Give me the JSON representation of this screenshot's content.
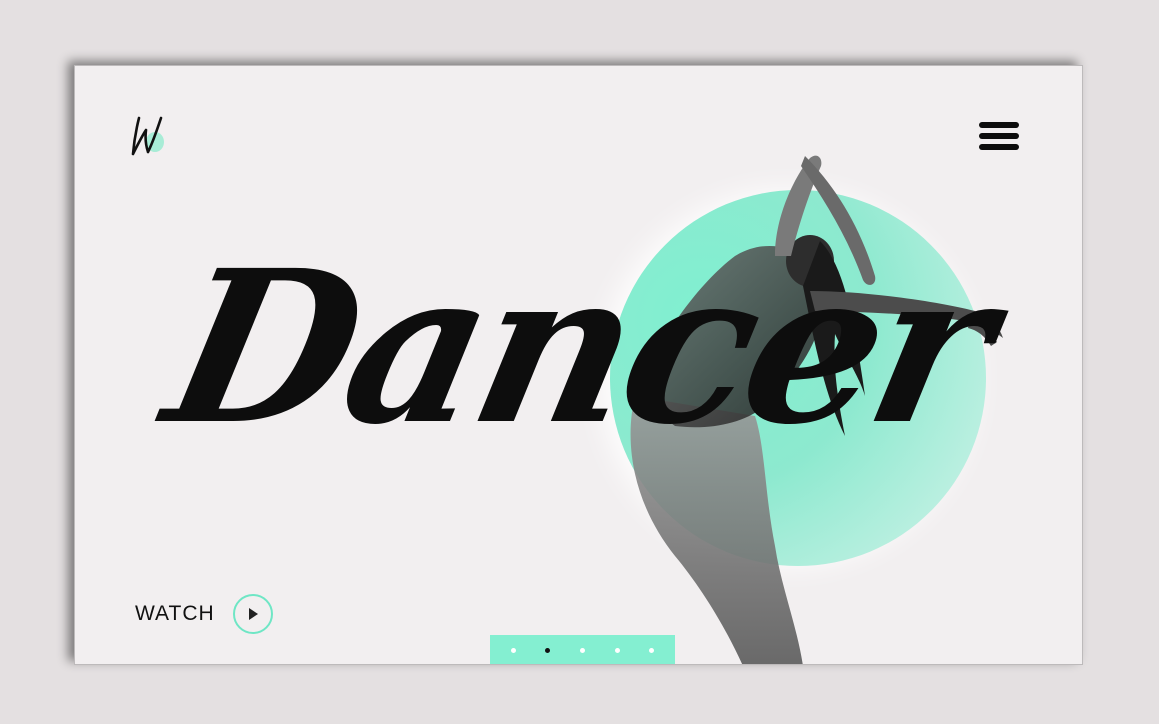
{
  "hero": {
    "title": "Dancer"
  },
  "watch": {
    "label": "WATCH"
  },
  "pager": {
    "dots": [
      {
        "active": false
      },
      {
        "active": true
      },
      {
        "active": false
      },
      {
        "active": false
      },
      {
        "active": false
      }
    ]
  },
  "icons": {
    "logo": "w-logo-icon",
    "menu": "hamburger-menu-icon",
    "play": "play-icon"
  },
  "colors": {
    "accent": "#84efd1",
    "card_background": "#f2eff0",
    "page_background": "#e4e0e1",
    "text": "#111111"
  }
}
